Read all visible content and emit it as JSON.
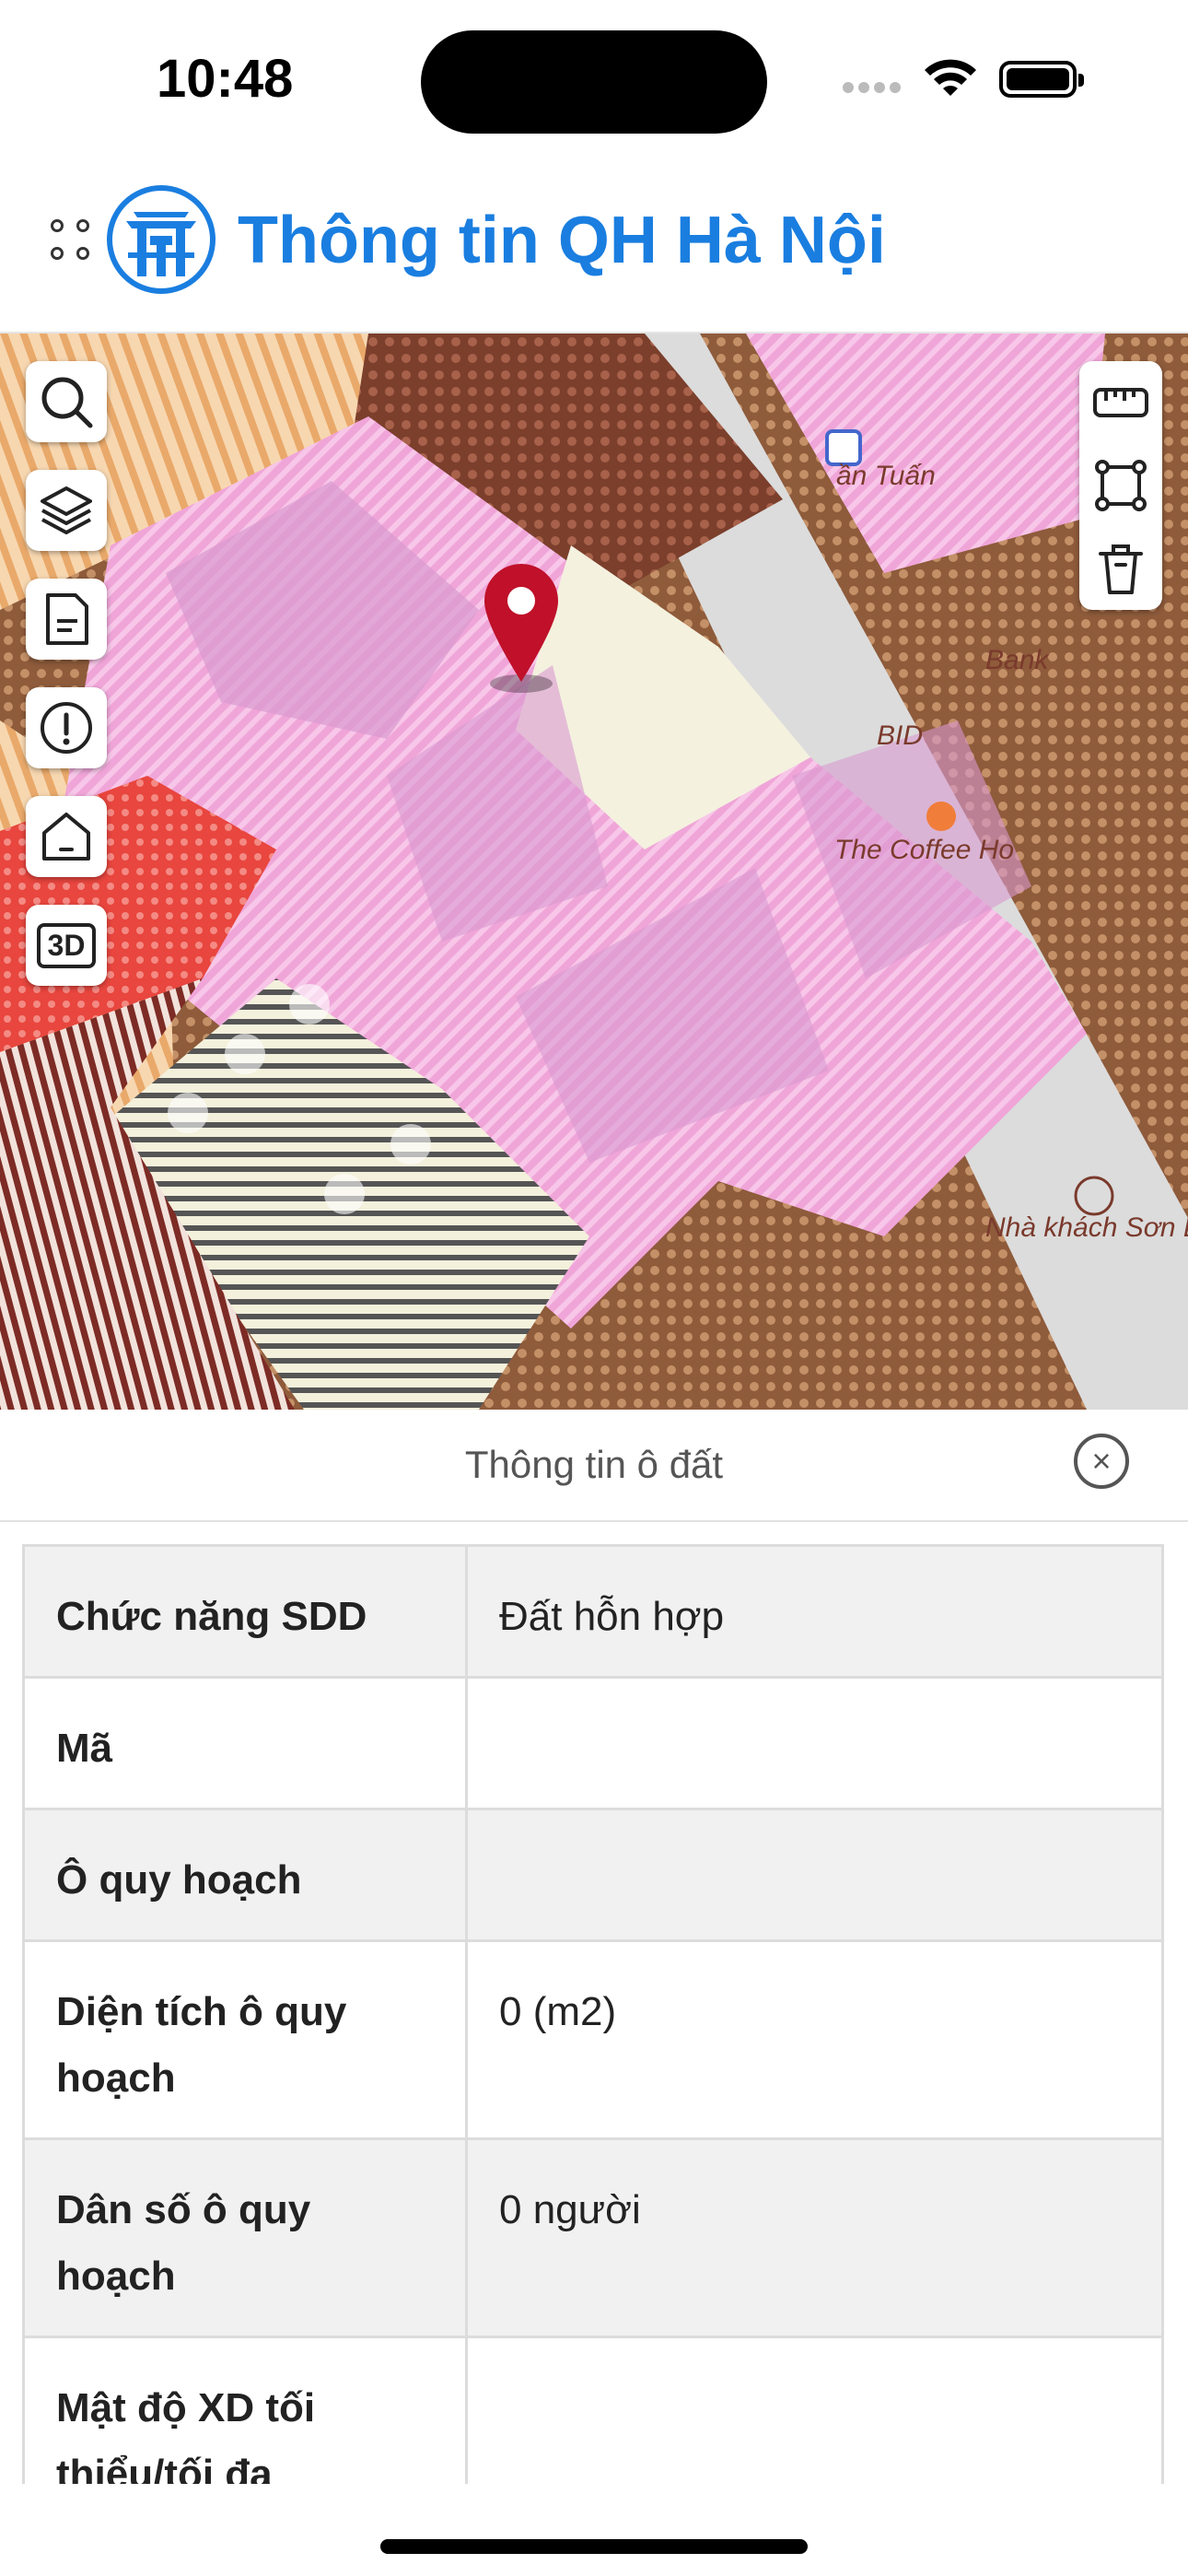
{
  "status_bar": {
    "time": "10:48"
  },
  "header": {
    "title": "Thông tin QH Hà Nội"
  },
  "map": {
    "labels": [
      "ần Tuấn",
      "Bank",
      "BID",
      "The Coffee Ho",
      "Nhà khách Sơn L"
    ],
    "left_controls": [
      "search-icon",
      "layers-icon",
      "document-icon",
      "info-icon",
      "home-icon",
      "3d-icon"
    ],
    "right_controls": [
      "ruler-icon",
      "area-icon",
      "trash-icon"
    ],
    "btn_3d": "3D"
  },
  "panel": {
    "title": "Thông tin ô đất",
    "rows": [
      {
        "key": "Chức năng SDD",
        "value": "Đất hỗn hợp"
      },
      {
        "key": "Mã",
        "value": ""
      },
      {
        "key": "Ô quy hoạch",
        "value": ""
      },
      {
        "key": "Diện tích ô quy hoạch",
        "value": "0 (m2)"
      },
      {
        "key": "Dân số ô quy hoạch",
        "value": "0 người"
      },
      {
        "key": "Mật độ XD tối thiểu/tối đa",
        "value": ""
      }
    ]
  }
}
